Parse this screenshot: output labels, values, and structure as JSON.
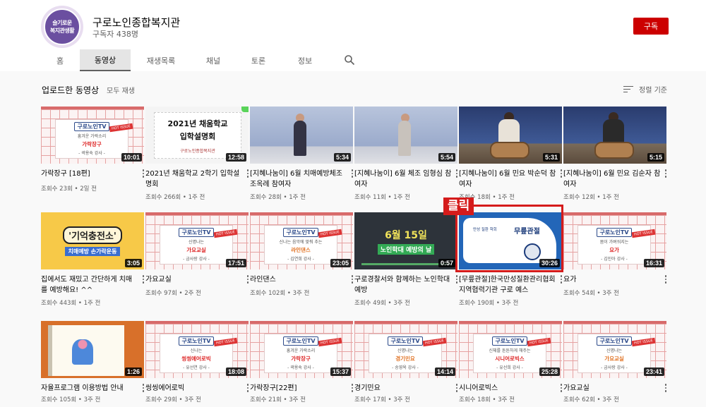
{
  "channel": {
    "name": "구로노인종합복지관",
    "subscribers": "구독자 438명",
    "avatar_lines": [
      "슬기로운",
      "복지관생활"
    ],
    "subscribe_label": "구독"
  },
  "tabs": [
    "홈",
    "동영상",
    "재생목록",
    "채널",
    "토론",
    "정보"
  ],
  "active_tab": "동영상",
  "section": {
    "title": "업로드한 동영상",
    "play_all": "모두 재생",
    "sort_label": "정렬 기준"
  },
  "annotation": {
    "label": "클릭"
  },
  "videos": [
    {
      "title": "가락장구 [18편]",
      "meta": "조회수 23회 • 2일 전",
      "duration": "10:01",
      "thumb_text": "가락장구",
      "thumb_sub": "흥겨운 가락소리",
      "thumb_teacher": "- 곽용숙 강사 -"
    },
    {
      "title": "2021년 채움학교 2학기 입학설명회",
      "meta": "조회수 266회 • 1주 전",
      "duration": "12:58",
      "thumb_lines": [
        "2021년 채움학교",
        "입학설명회",
        "구로노인종합복지관"
      ]
    },
    {
      "title": "[지혜나눔이] 6월 치매예방체조 조옥례 참여자",
      "meta": "조회수 28회 • 1주 전",
      "duration": "5:34"
    },
    {
      "title": "[지혜나눔이] 6월 체조 임형심 참여자",
      "meta": "조회수 11회 • 1주 전",
      "duration": "5:54"
    },
    {
      "title": "[지혜나눔이] 6월 민요 박순덕 참여자",
      "meta": "조회수 18회 • 1주 전",
      "duration": "5:31"
    },
    {
      "title": "[지혜나눔이] 6월 민요 김순자 참여자",
      "meta": "조회수 12회 • 1주 전",
      "duration": "5:15"
    },
    {
      "title": "집에서도 재밌고 간단하게 치매를 예방해요! ^^",
      "meta": "조회수 443회 • 1주 전",
      "duration": "3:05",
      "thumb_lines": [
        "'기억충전소'",
        "치매예방 손가락운동"
      ]
    },
    {
      "title": "가요교실",
      "meta": "조회수 97회 • 2주 전",
      "duration": "17:51",
      "thumb_text": "가요교실",
      "thumb_sub": "신명나는",
      "thumb_teacher": "- 금사랑 강사 -"
    },
    {
      "title": "라인댄스",
      "meta": "조회수 102회 • 3주 전",
      "duration": "23:05",
      "thumb_text": "라인댄스",
      "thumb_sub": "신나는 음악에 맞춰 추는",
      "thumb_teacher": "- 김연희 강사 -"
    },
    {
      "title": "구로경찰서와 함께하는 노인학대 예방",
      "meta": "조회수 49회 • 3주 전",
      "duration": "0:57",
      "thumb_lines": [
        "6월 15일",
        "노인학대 예방의 날"
      ]
    },
    {
      "title": "[무릎관절]한국만성질환관리협회 지역협력기관 구로 예스",
      "meta": "조회수 190회 • 3주 전",
      "duration": "30:26",
      "thumb_lines": [
        "무릎관절",
        "만성 질환 학회"
      ]
    },
    {
      "title": "요가",
      "meta": "조회수 54회 • 3주 전",
      "duration": "16:31",
      "thumb_text": "요가",
      "thumb_sub": "몸이 가벼워지는",
      "thumb_teacher": "- 김민아 강사 -"
    },
    {
      "title": "자율프로그램 이용방법 안내",
      "meta": "조회수 105회 • 3주 전",
      "duration": "1:26"
    },
    {
      "title": "씽씽에어로빅",
      "meta": "조회수 29회 • 3주 전",
      "duration": "18:08",
      "thumb_text": "씽씽에어로빅",
      "thumb_sub": "신나는",
      "thumb_teacher": "- 유선연 강사 -"
    },
    {
      "title": "가락장구[22편]",
      "meta": "조회수 21회 • 3주 전",
      "duration": "15:37",
      "thumb_text": "가락장구",
      "thumb_sub": "흥겨운 가락소리",
      "thumb_teacher": "- 곽용숙 강사 -"
    },
    {
      "title": "경기민요",
      "meta": "조회수 17회 • 3주 전",
      "duration": "14:14",
      "thumb_text": "경기민요",
      "thumb_sub": "신명나는",
      "thumb_teacher": "- 송영옥 강사 -"
    },
    {
      "title": "시니어로빅스",
      "meta": "조회수 18회 • 3주 전",
      "duration": "25:28",
      "thumb_text": "시니어로빅스",
      "thumb_sub": "신체를 튼튼하게 해주는",
      "thumb_teacher": "- 유선희 강사 -"
    },
    {
      "title": "가요교실",
      "meta": "조회수 62회 • 3주 전",
      "duration": "23:41",
      "thumb_text": "가요교실",
      "thumb_sub": "신명나는",
      "thumb_teacher": "- 금사랑 강사 -"
    }
  ]
}
